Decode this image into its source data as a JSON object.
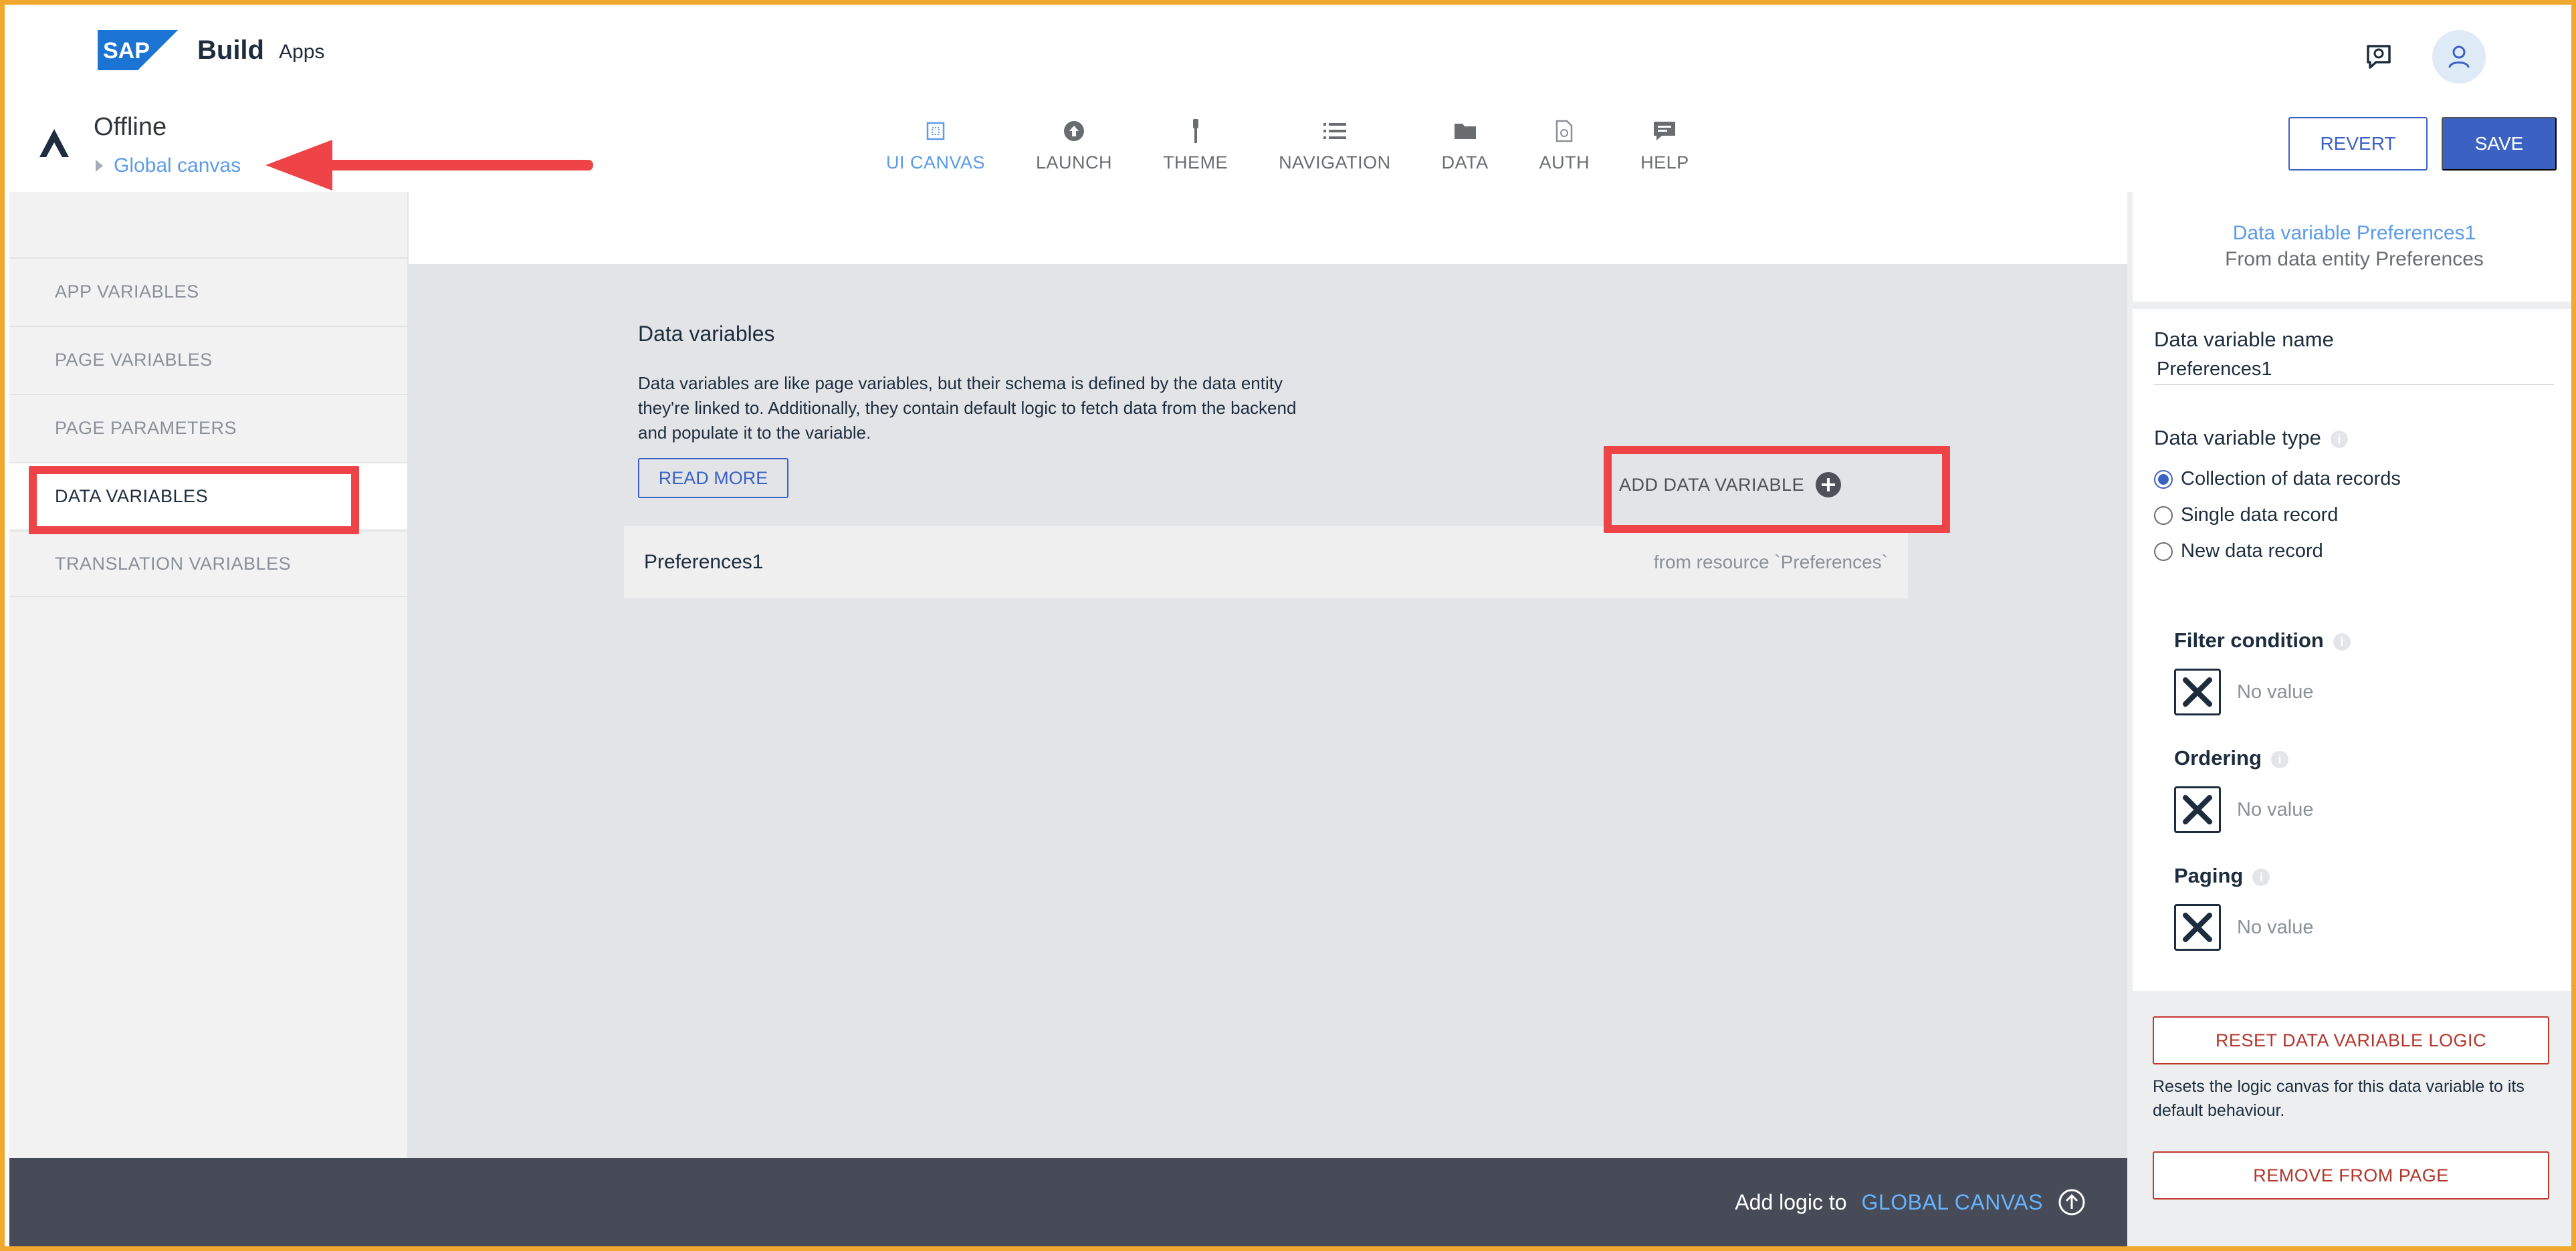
{
  "shell": {
    "logo_text": "SAP",
    "product": "Build",
    "product_sub": "Apps",
    "icons": [
      "feedback-icon",
      "user-avatar-icon"
    ]
  },
  "app": {
    "name": "Offline",
    "breadcrumb": "Global canvas"
  },
  "nav": {
    "tabs": [
      {
        "label": "UI CANVAS",
        "icon": "ui-canvas-icon",
        "active": true
      },
      {
        "label": "LAUNCH",
        "icon": "launch-icon",
        "active": false
      },
      {
        "label": "THEME",
        "icon": "theme-icon",
        "active": false
      },
      {
        "label": "NAVIGATION",
        "icon": "navigation-icon",
        "active": false
      },
      {
        "label": "DATA",
        "icon": "data-folder-icon",
        "active": false
      },
      {
        "label": "AUTH",
        "icon": "auth-icon",
        "active": false
      },
      {
        "label": "HELP",
        "icon": "help-icon",
        "active": false
      }
    ]
  },
  "toolbar": {
    "revert_label": "REVERT",
    "save_label": "SAVE"
  },
  "sidebar": {
    "items": [
      {
        "label": "APP VARIABLES"
      },
      {
        "label": "PAGE VARIABLES"
      },
      {
        "label": "PAGE PARAMETERS"
      },
      {
        "label": "DATA VARIABLES"
      },
      {
        "label": "TRANSLATION VARIABLES"
      }
    ],
    "active_index": 3
  },
  "main": {
    "title": "Data variables",
    "description": "Data variables are like page variables, but their schema is defined by the data entity they're linked to. Additionally, they contain default logic to fetch data from the backend and populate it to the variable.",
    "read_more_label": "READ MORE",
    "add_label": "ADD DATA VARIABLE",
    "variables": [
      {
        "name": "Preferences1",
        "source": "from resource `Preferences`"
      }
    ]
  },
  "bottom": {
    "label": "Add logic to",
    "link": "GLOBAL CANVAS"
  },
  "panel": {
    "title": "Data variable Preferences1",
    "subtitle": "From data entity Preferences",
    "name_label": "Data variable name",
    "name_value": "Preferences1",
    "type_label": "Data variable type",
    "types": [
      {
        "label": "Collection of data records",
        "selected": true
      },
      {
        "label": "Single data record",
        "selected": false
      },
      {
        "label": "New data record",
        "selected": false
      }
    ],
    "filter_label": "Filter condition",
    "ordering_label": "Ordering",
    "paging_label": "Paging",
    "no_value": "No value",
    "reset_label": "RESET DATA VARIABLE LOGIC",
    "reset_desc": "Resets the logic canvas for this data variable to its default behaviour.",
    "remove_label": "REMOVE FROM PAGE"
  },
  "colors": {
    "accent": "#3b62c3",
    "link": "#5b9be8",
    "annotation": "#ee4447",
    "bottom_bar": "#464b57",
    "frame": "#f0a92e"
  }
}
